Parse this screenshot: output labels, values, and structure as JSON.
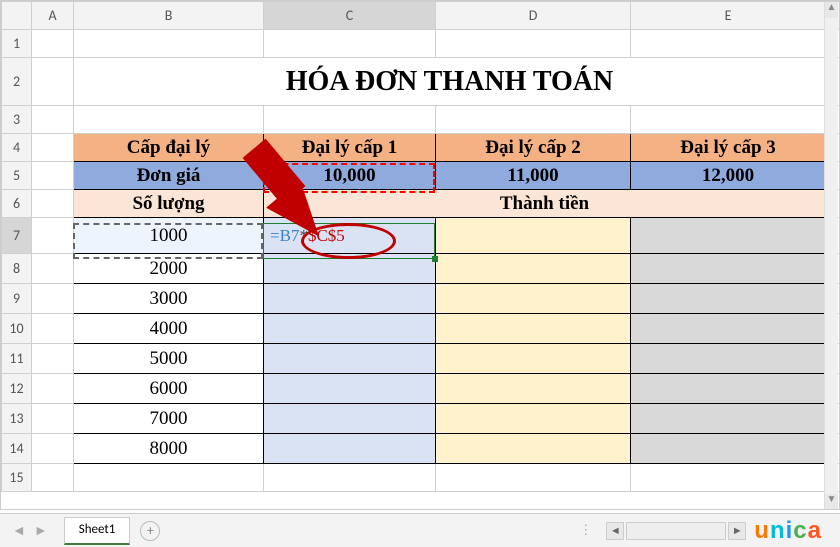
{
  "columns": [
    "A",
    "B",
    "C",
    "D",
    "E"
  ],
  "rows": [
    "1",
    "2",
    "3",
    "4",
    "5",
    "6",
    "7",
    "8",
    "9",
    "10",
    "11",
    "12",
    "13",
    "14",
    "15"
  ],
  "title": "HÓA ĐƠN THANH TOÁN",
  "headers": {
    "r4": {
      "b": "Cấp đại lý",
      "c": "Đại lý cấp 1",
      "d": "Đại lý cấp 2",
      "e": "Đại lý cấp 3"
    },
    "r5": {
      "b": "Đơn giá",
      "c": "10,000",
      "d": "11,000",
      "e": "12,000"
    },
    "r6": {
      "b": "Số lượng",
      "cde": "Thành tiền"
    }
  },
  "qty": [
    "1000",
    "2000",
    "3000",
    "4000",
    "5000",
    "6000",
    "7000",
    "8000"
  ],
  "formula": {
    "pre": "=B7",
    "op": "*",
    "abs": "$C$5"
  },
  "tab": "Sheet1",
  "logo": {
    "u": "u",
    "n": "n",
    "i": "i",
    "c": "c",
    "a": "a"
  }
}
